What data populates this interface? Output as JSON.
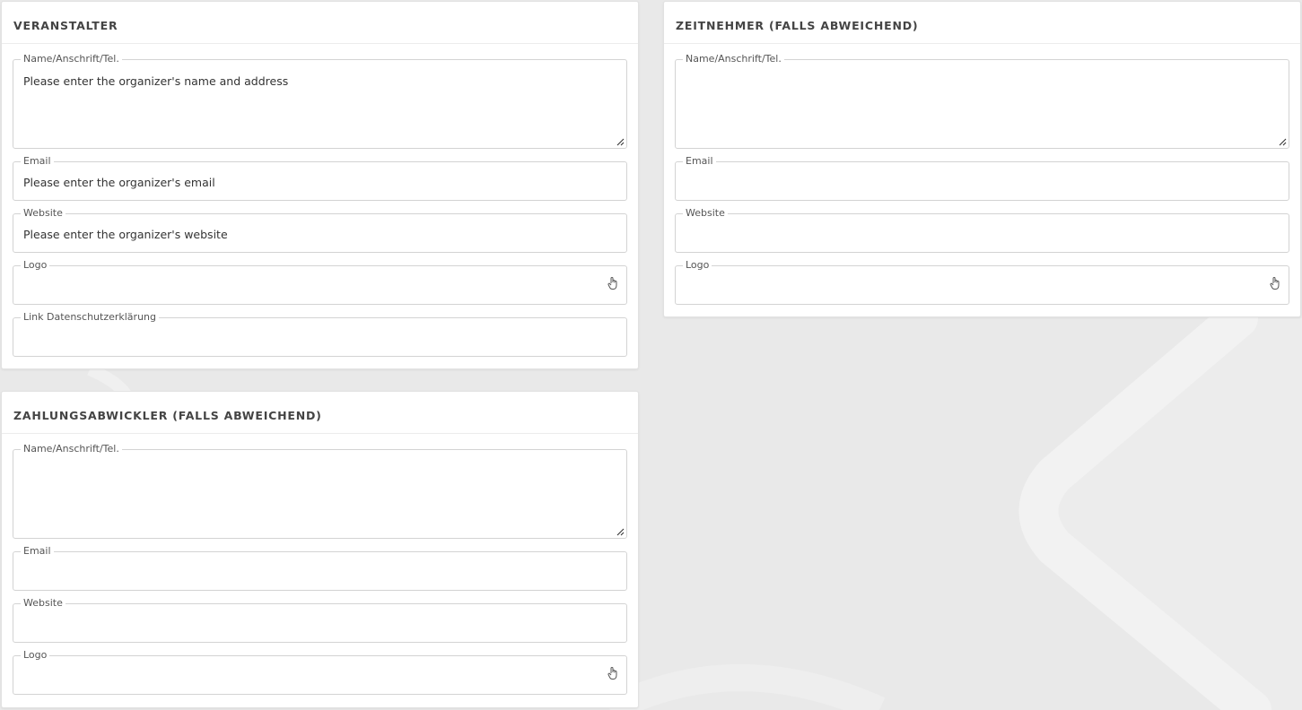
{
  "organizer": {
    "title": "VERANSTALTER",
    "fields": [
      {
        "label": "Name/Anschrift/Tel.",
        "value": "Please enter the organizer's name and address"
      },
      {
        "label": "Email",
        "value": "Please enter the organizer's email"
      },
      {
        "label": "Website",
        "value": "Please enter the organizer's website"
      },
      {
        "label": "Logo",
        "value": ""
      },
      {
        "label": "Link Datenschutzerklärung",
        "value": ""
      }
    ]
  },
  "timekeeper": {
    "title": "ZEITNEHMER (FALLS ABWEICHEND)",
    "fields": [
      {
        "label": "Name/Anschrift/Tel.",
        "value": ""
      },
      {
        "label": "Email",
        "value": ""
      },
      {
        "label": "Website",
        "value": ""
      },
      {
        "label": "Logo",
        "value": ""
      }
    ]
  },
  "payment": {
    "title": "ZAHLUNGSABWICKLER (FALLS ABWEICHEND)",
    "fields": [
      {
        "label": "Name/Anschrift/Tel.",
        "value": ""
      },
      {
        "label": "Email",
        "value": ""
      },
      {
        "label": "Website",
        "value": ""
      },
      {
        "label": "Logo",
        "value": ""
      }
    ]
  },
  "icons": {
    "logo_picker": "hand-pointer-icon",
    "textarea_resize": "resize-handle-icon"
  },
  "colors": {
    "background": "#e9e9e9",
    "card": "#ffffff",
    "border": "#d3d3d3",
    "title_text": "#444444"
  }
}
